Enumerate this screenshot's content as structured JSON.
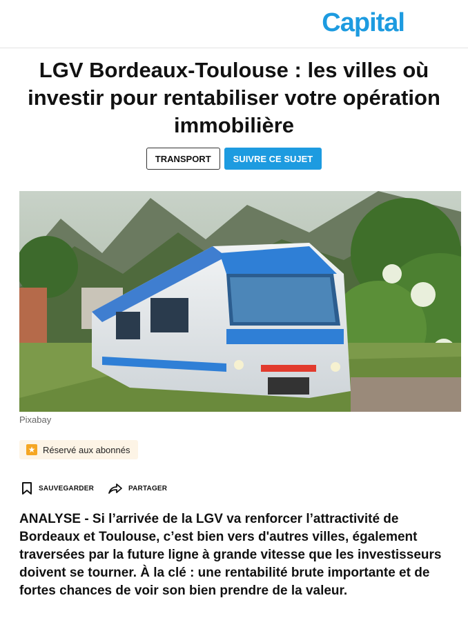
{
  "header": {
    "logo_text": "Capital",
    "logo_color": "#1d9be0"
  },
  "article": {
    "title": "LGV Bordeaux-Toulouse : les villes où investir pour rentabiliser votre opération immobilière",
    "tags": {
      "category": "TRANSPORT",
      "follow_label": "SUIVRE CE SUJET"
    },
    "image_credit": "Pixabay",
    "subscriber_badge": "Réservé aux abonnés",
    "actions": {
      "save_label": "SAUVEGARDER",
      "share_label": "PARTAGER"
    },
    "lead": "ANALYSE - Si l’arrivée de la LGV va renforcer l’attractivité de Bordeaux et Toulouse, c’est bien vers d'autres villes, également traversées par la future ligne à grande vitesse que les investisseurs doivent se tourner. À la clé : une rentabilité brute importante et de fortes chances de voir son bien prendre de la valeur."
  },
  "icons": {
    "save": "bookmark-icon",
    "share": "share-arrow-icon",
    "badge": "star-icon"
  }
}
